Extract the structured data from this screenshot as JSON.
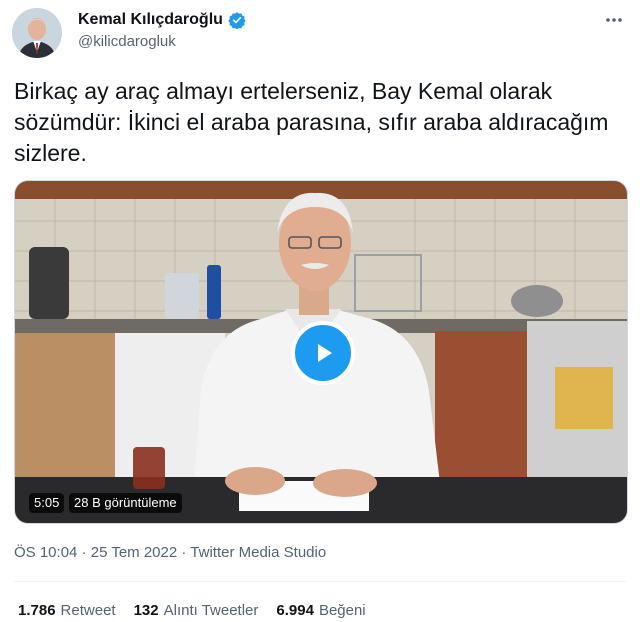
{
  "author": {
    "display_name": "Kemal Kılıçdaroğlu",
    "handle": "@kilicdarogluk",
    "avatar_icon": "person-avatar",
    "verified_icon": "verified-badge-icon"
  },
  "tweet": {
    "text": "Birkaç ay araç almayı ertelerseniz, Bay Kemal olarak sözümdür: İkinci el araba parasına, sıfır araba aldıracağım sizlere."
  },
  "video": {
    "duration": "5:05",
    "views": "28 B görüntüleme",
    "play_icon": "play-icon"
  },
  "meta": {
    "time": "ÖS 10:04",
    "separator": "·",
    "date": "25 Tem 2022",
    "source": "Twitter Media Studio"
  },
  "stats": {
    "retweets_count": "1.786",
    "retweets_label": "Retweet",
    "quotes_count": "132",
    "quotes_label": "Alıntı Tweetler",
    "likes_count": "6.994",
    "likes_label": "Beğeni"
  },
  "colors": {
    "accent": "#1d9bf0",
    "text": "#0f1419",
    "muted": "#536471"
  }
}
